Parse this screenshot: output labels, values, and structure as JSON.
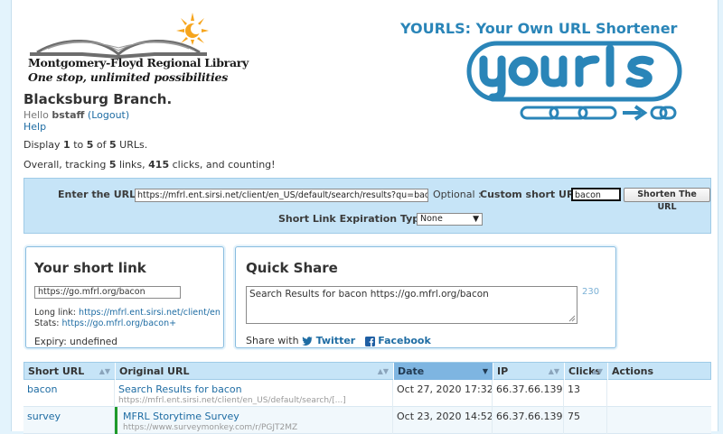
{
  "library": {
    "name": "Montgomery-Floyd Regional Library",
    "tagline": "One stop, unlimited possibilities"
  },
  "branch": "Blacksburg Branch.",
  "user": {
    "hello": "Hello",
    "name": "bstaff",
    "logout": "(Logout)",
    "help": "Help"
  },
  "stats": {
    "display_prefix": "Display",
    "from": "1",
    "to_word": "to",
    "to": "5",
    "of_word": "of",
    "total": "5",
    "suffix": "URLs.",
    "overall_prefix": "Overall, tracking",
    "links": "5",
    "links_word": "links,",
    "clicks": "415",
    "clicks_word": "clicks, and counting!"
  },
  "brand": {
    "title": "YOURLS: Your Own URL Shortener"
  },
  "form": {
    "url_label": "Enter the URL:",
    "url_value": "https://mfrl.ent.sirsi.net/client/en_US/default/search/results?qu=bacon&qf=ITYPE",
    "optional_label": "Optional :",
    "custom_label": "Custom short URL:",
    "custom_value": "bacon",
    "shorten_button": "Shorten The URL",
    "expiry_label": "Short Link Expiration Type:",
    "expiry_value": "None"
  },
  "short_link": {
    "title": "Your short link",
    "url": "https://go.mfrl.org/bacon",
    "long_label": "Long link:",
    "long_value": "https://mfrl.ent.sirsi.net/client/en_US",
    "stats_label": "Stats:",
    "stats_value": "https://go.mfrl.org/bacon+",
    "expiry": "Expiry: undefined"
  },
  "quick_share": {
    "title": "Quick Share",
    "text": "Search Results for bacon https://go.mfrl.org/bacon",
    "count": "230",
    "share_with": "Share with",
    "twitter": "Twitter",
    "facebook": "Facebook"
  },
  "table": {
    "headers": [
      "Short URL",
      "Original URL",
      "Date",
      "IP",
      "Clicks",
      "Actions"
    ],
    "rows": [
      {
        "short": "bacon",
        "title": "Search Results for bacon",
        "url": "https://mfrl.ent.sirsi.net/client/en_US/default/search/[...]",
        "date": "Oct 27, 2020 17:32",
        "ip": "66.37.66.139",
        "clicks": "13"
      },
      {
        "short": "survey",
        "title": "MFRL Storytime Survey",
        "url": "https://www.surveymonkey.com/r/PGJT2MZ",
        "date": "Oct 23, 2020 14:52",
        "ip": "66.37.66.139",
        "clicks": "75"
      }
    ]
  },
  "colors": {
    "accent": "#2a85b8",
    "band": "#c6e4f7",
    "sorted_header": "#7eb5e1",
    "sun": "#f6a51d",
    "new_row_marker": "#1e9a2a"
  }
}
